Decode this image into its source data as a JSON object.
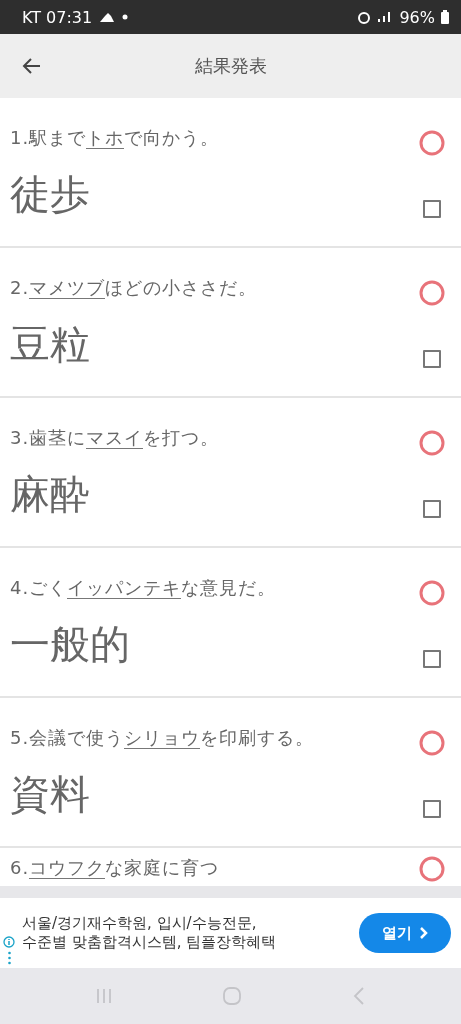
{
  "status_bar": {
    "carrier_time": "KT 07:31",
    "battery": "96%"
  },
  "app_bar": {
    "title": "結果発表"
  },
  "questions": [
    {
      "before": "1.駅まで",
      "underlined": "トホ",
      "after": "で向かう。",
      "answer": "徒歩",
      "correct": true,
      "checked": false
    },
    {
      "before": "2.",
      "underlined": "マメツブ",
      "after": "ほどの小ささだ。",
      "answer": "豆粒",
      "correct": true,
      "checked": false
    },
    {
      "before": "3.歯茎に",
      "underlined": "マスイ",
      "after": "を打つ。",
      "answer": "麻酔",
      "correct": true,
      "checked": false
    },
    {
      "before": "4.ごく",
      "underlined": "イッパンテキ",
      "after": "な意見だ。",
      "answer": "一般的",
      "correct": true,
      "checked": false
    },
    {
      "before": "5.会議で使う",
      "underlined": "シリョウ",
      "after": "を印刷する。",
      "answer": "資料",
      "correct": true,
      "checked": false
    },
    {
      "before": "6.",
      "underlined": "コウフク",
      "after": "な家庭に育つ",
      "correct": true
    }
  ],
  "ad": {
    "lines": [
      "서울/경기재수학원, 입시/수능전문,",
      "수준별 맞춤합격시스템, 팀플장학혜택"
    ],
    "button": "열기"
  }
}
